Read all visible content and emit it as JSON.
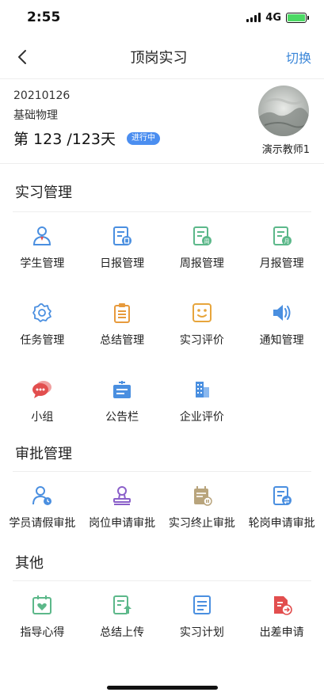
{
  "status_bar": {
    "time": "2:55",
    "network": "4G"
  },
  "nav": {
    "back_icon": "chevron-left-icon",
    "title": "顶岗实习",
    "switch_label": "切换"
  },
  "info": {
    "code": "20210126",
    "course": "基础物理",
    "progress": "第 123 /123天",
    "status_badge": "进行中",
    "teacher": "演示教师1"
  },
  "sections": {
    "internship": {
      "title": "实习管理",
      "items": [
        {
          "label": "学生管理",
          "icon": "user-icon",
          "color": "#4a8fe0"
        },
        {
          "label": "日报管理",
          "icon": "daily-report-icon",
          "color": "#4a8fe0"
        },
        {
          "label": "周报管理",
          "icon": "weekly-report-icon",
          "color": "#5cb88a"
        },
        {
          "label": "月报管理",
          "icon": "monthly-report-icon",
          "color": "#5cb88a"
        },
        {
          "label": "任务管理",
          "icon": "gear-icon",
          "color": "#4a8fe0"
        },
        {
          "label": "总结管理",
          "icon": "clipboard-icon",
          "color": "#e79a3c"
        },
        {
          "label": "实习评价",
          "icon": "smile-icon",
          "color": "#e7a53c"
        },
        {
          "label": "通知管理",
          "icon": "speaker-icon",
          "color": "#4a8fe0"
        },
        {
          "label": "小组",
          "icon": "chat-bubbles-icon",
          "color": "#e24e4e"
        },
        {
          "label": "公告栏",
          "icon": "bulletin-icon",
          "color": "#4a8fe0"
        },
        {
          "label": "企业评价",
          "icon": "building-icon",
          "color": "#4a8fe0"
        }
      ]
    },
    "approval": {
      "title": "审批管理",
      "items": [
        {
          "label": "学员请假审批",
          "icon": "user-clock-icon",
          "color": "#4a8fe0"
        },
        {
          "label": "岗位申请审批",
          "icon": "stamp-icon",
          "color": "#8a5fc9"
        },
        {
          "label": "实习终止审批",
          "icon": "calendar-pause-icon",
          "color": "#b8a47c"
        },
        {
          "label": "轮岗申请审批",
          "icon": "document-swap-icon",
          "color": "#4a8fe0"
        }
      ]
    },
    "other": {
      "title": "其他",
      "items": [
        {
          "label": "指导心得",
          "icon": "heart-board-icon",
          "color": "#5cb88a"
        },
        {
          "label": "总结上传",
          "icon": "upload-doc-icon",
          "color": "#5cb88a"
        },
        {
          "label": "实习计划",
          "icon": "plan-doc-icon",
          "color": "#4a8fe0"
        },
        {
          "label": "出差申请",
          "icon": "trip-doc-icon",
          "color": "#e24e4e"
        }
      ]
    }
  }
}
